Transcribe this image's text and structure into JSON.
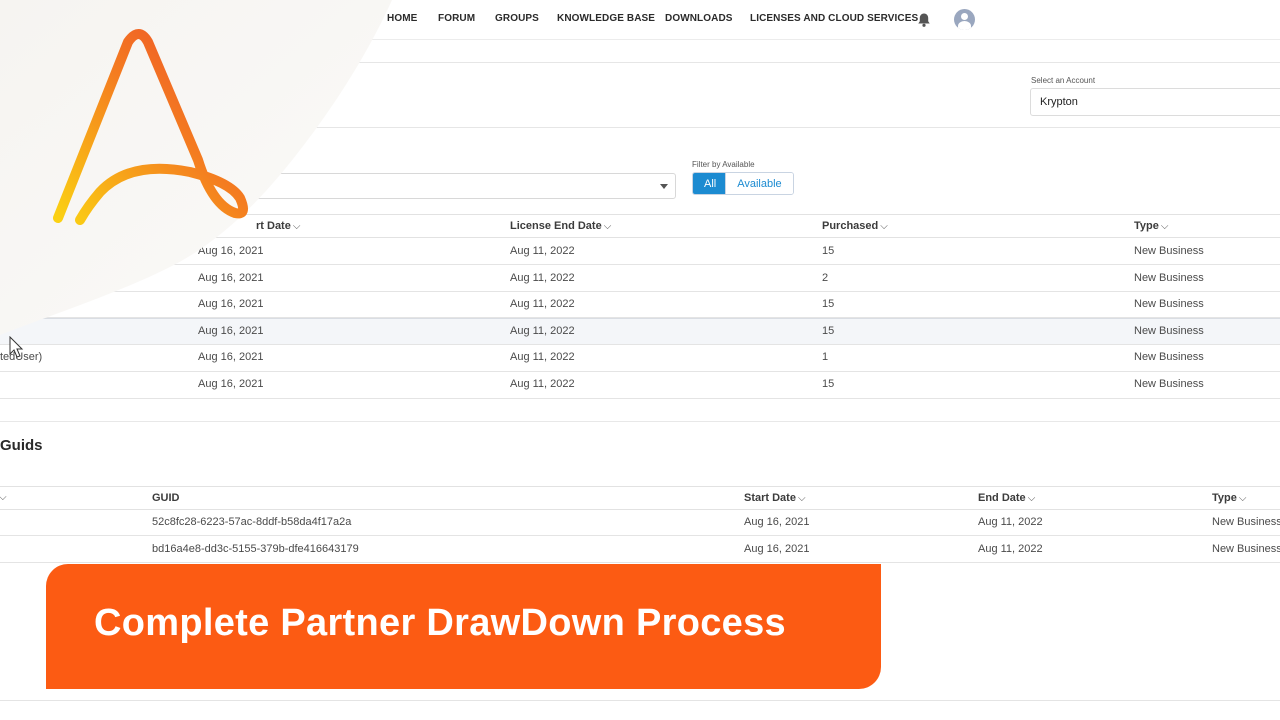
{
  "nav": {
    "items": [
      "HOME",
      "FORUM",
      "GROUPS",
      "KNOWLEDGE BASE",
      "DOWNLOADS",
      "LICENSES AND CLOUD SERVICES"
    ],
    "bell_icon": "bell-icon",
    "avatar_icon": "user-avatar-icon"
  },
  "account": {
    "label": "Select an Account",
    "value": "Krypton"
  },
  "filter": {
    "label": "Filter by Available",
    "options": [
      "All",
      "Available"
    ],
    "selected": "All"
  },
  "licenses_table": {
    "headers": [
      "rt Date",
      "License End Date",
      "Purchased",
      "Type"
    ],
    "rows": [
      {
        "name": "",
        "start": "Aug 16, 2021",
        "end": "Aug 11, 2022",
        "purchased": "15",
        "type": "New Business"
      },
      {
        "name": "",
        "start": "Aug 16, 2021",
        "end": "Aug 11, 2022",
        "purchased": "2",
        "type": "New Business"
      },
      {
        "name": "",
        "start": "Aug 16, 2021",
        "end": "Aug 11, 2022",
        "purchased": "15",
        "type": "New Business"
      },
      {
        "name": "",
        "start": "Aug 16, 2021",
        "end": "Aug 11, 2022",
        "purchased": "15",
        "type": "New Business"
      },
      {
        "name": "tedUser)",
        "start": "Aug 16, 2021",
        "end": "Aug 11, 2022",
        "purchased": "1",
        "type": "New Business"
      },
      {
        "name": "",
        "start": "Aug 16, 2021",
        "end": "Aug 11, 2022",
        "purchased": "15",
        "type": "New Business"
      }
    ]
  },
  "guids_section": {
    "title": "Guids",
    "headers": [
      "GUID",
      "Start Date",
      "End Date",
      "Type"
    ],
    "rows": [
      {
        "guid": "52c8fc28-6223-57ac-8ddf-b58da4f17a2a",
        "start": "Aug 16, 2021",
        "end": "Aug 11, 2022",
        "type": "New Business"
      },
      {
        "guid": "bd16a4e8-dd3c-5155-379b-dfe416643179",
        "start": "Aug 16, 2021",
        "end": "Aug 11, 2022",
        "type": "New Business"
      }
    ]
  },
  "banner": {
    "text": "Complete Partner DrawDown Process"
  },
  "colors": {
    "accent_blue": "#1c8bd1",
    "banner_orange": "#fc5b13",
    "logo_gradient": [
      "#fbd113",
      "#f47c20",
      "#ec4a2c"
    ]
  }
}
